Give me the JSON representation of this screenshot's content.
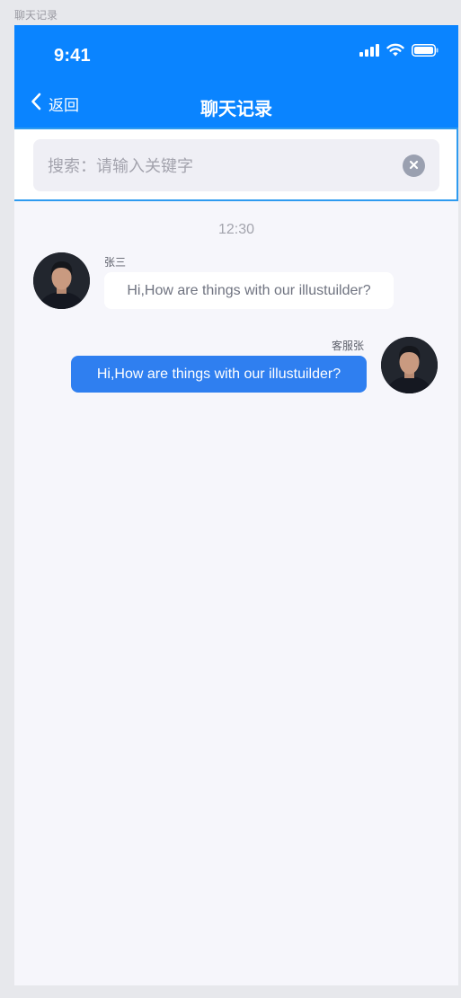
{
  "canvas_label": "聊天记录",
  "status_bar": {
    "time": "9:41",
    "icons": [
      "signal-icon",
      "wifi-icon",
      "battery-icon"
    ]
  },
  "navbar": {
    "back_label": "返回",
    "title": "聊天记录"
  },
  "search": {
    "placeholder": "搜索：请输入关键字",
    "value": ""
  },
  "chat": {
    "timestamp": "12:30",
    "messages": [
      {
        "direction": "incoming",
        "sender": "张三",
        "text": "Hi,How are things with our illustuilder?"
      },
      {
        "direction": "outgoing",
        "sender": "客服张",
        "text": "Hi,How are things with our illustuilder?"
      }
    ]
  },
  "colors": {
    "accent": "#0a84ff",
    "outgoing_bubble": "#2f7ff0",
    "search_border": "#2e9bf0",
    "background": "#f6f6fb"
  }
}
